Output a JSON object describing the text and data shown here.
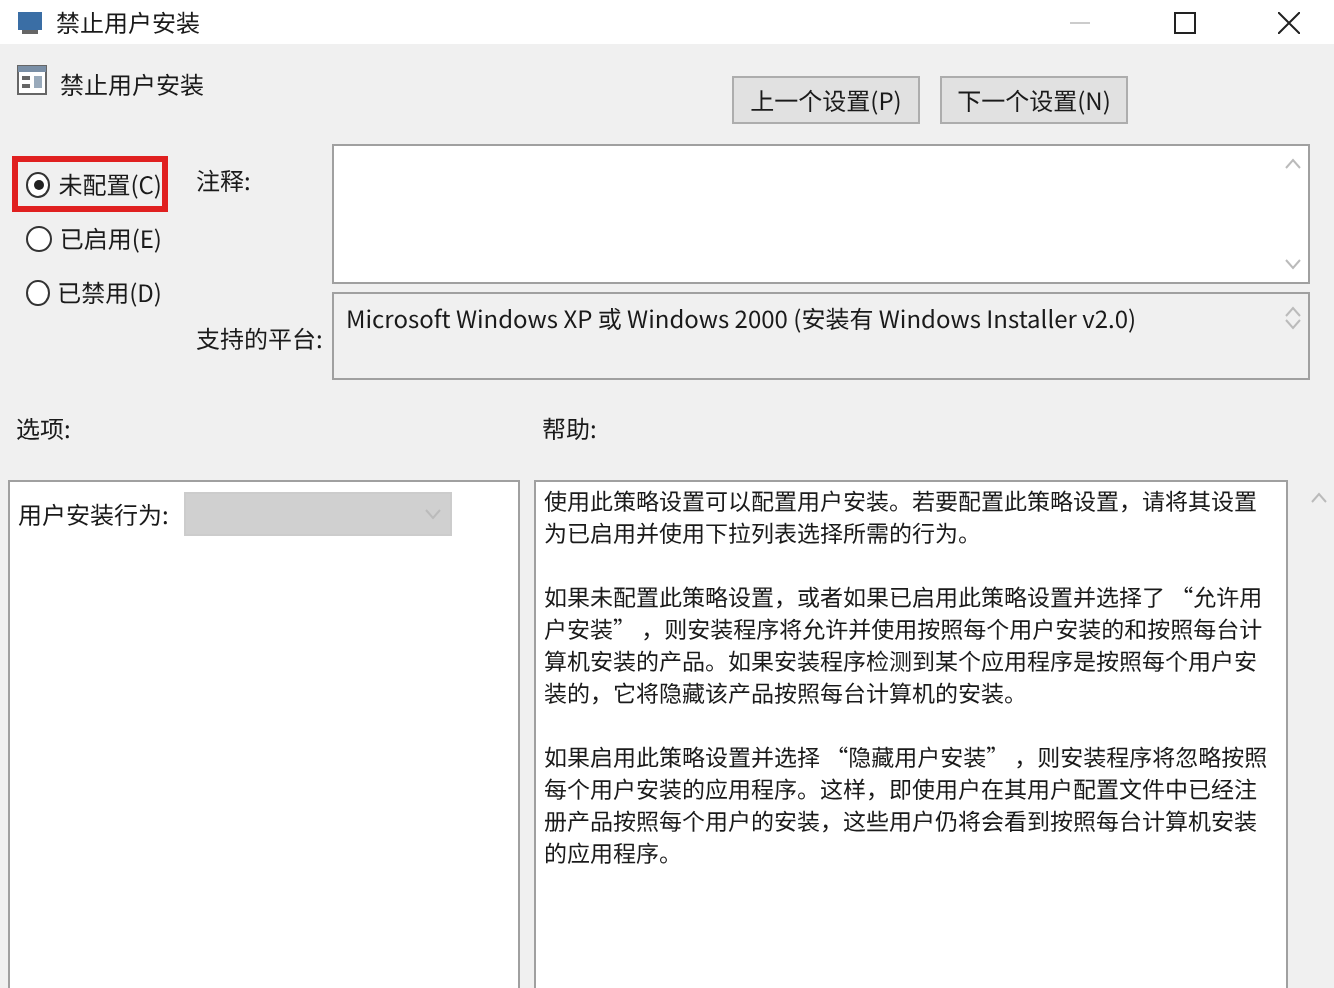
{
  "window": {
    "title": "禁止用户安装"
  },
  "header": {
    "title": "禁止用户安装"
  },
  "nav_buttons": [
    "上一个设置(P)",
    "下一个设置(N)"
  ],
  "states": [
    {
      "label": "未配置(C)",
      "selected": true,
      "highlighted": true
    },
    {
      "label": "已启用(E)",
      "selected": false,
      "highlighted": false
    },
    {
      "label": "已禁用(D)",
      "selected": false,
      "highlighted": false
    }
  ],
  "comment": {
    "label": "注释:"
  },
  "platform": {
    "label": "支持的平台:",
    "value": "Microsoft Windows XP 或 Windows 2000 (安装有 Windows Installer v2.0)"
  },
  "options": {
    "label": "选项:",
    "field_label": "用户安装行为:",
    "dropdown_disabled": true
  },
  "help": {
    "label": "帮助:",
    "paragraphs": [
      "使用此策略设置可以配置用户安装。若要配置此策略设置，请将其设置为已启用并使用下拉列表选择所需的行为。",
      "如果未配置此策略设置，或者如果已启用此策略设置并选择了 “允许用户安装” ，则安装程序将允许并使用按照每个用户安装的和按照每台计算机安装的产品。如果安装程序检测到某个应用程序是按照每个用户安装的，它将隐藏该产品按照每台计算机的安装。",
      "如果启用此策略设置并选择 “隐藏用户安装” ，则安装程序将忽略按照每个用户安装的应用程序。这样，即使用户在其用户配置文件中已经注册产品按照每个用户的安装，这些用户仍将会看到按照每台计算机安装的应用程序。"
    ]
  }
}
